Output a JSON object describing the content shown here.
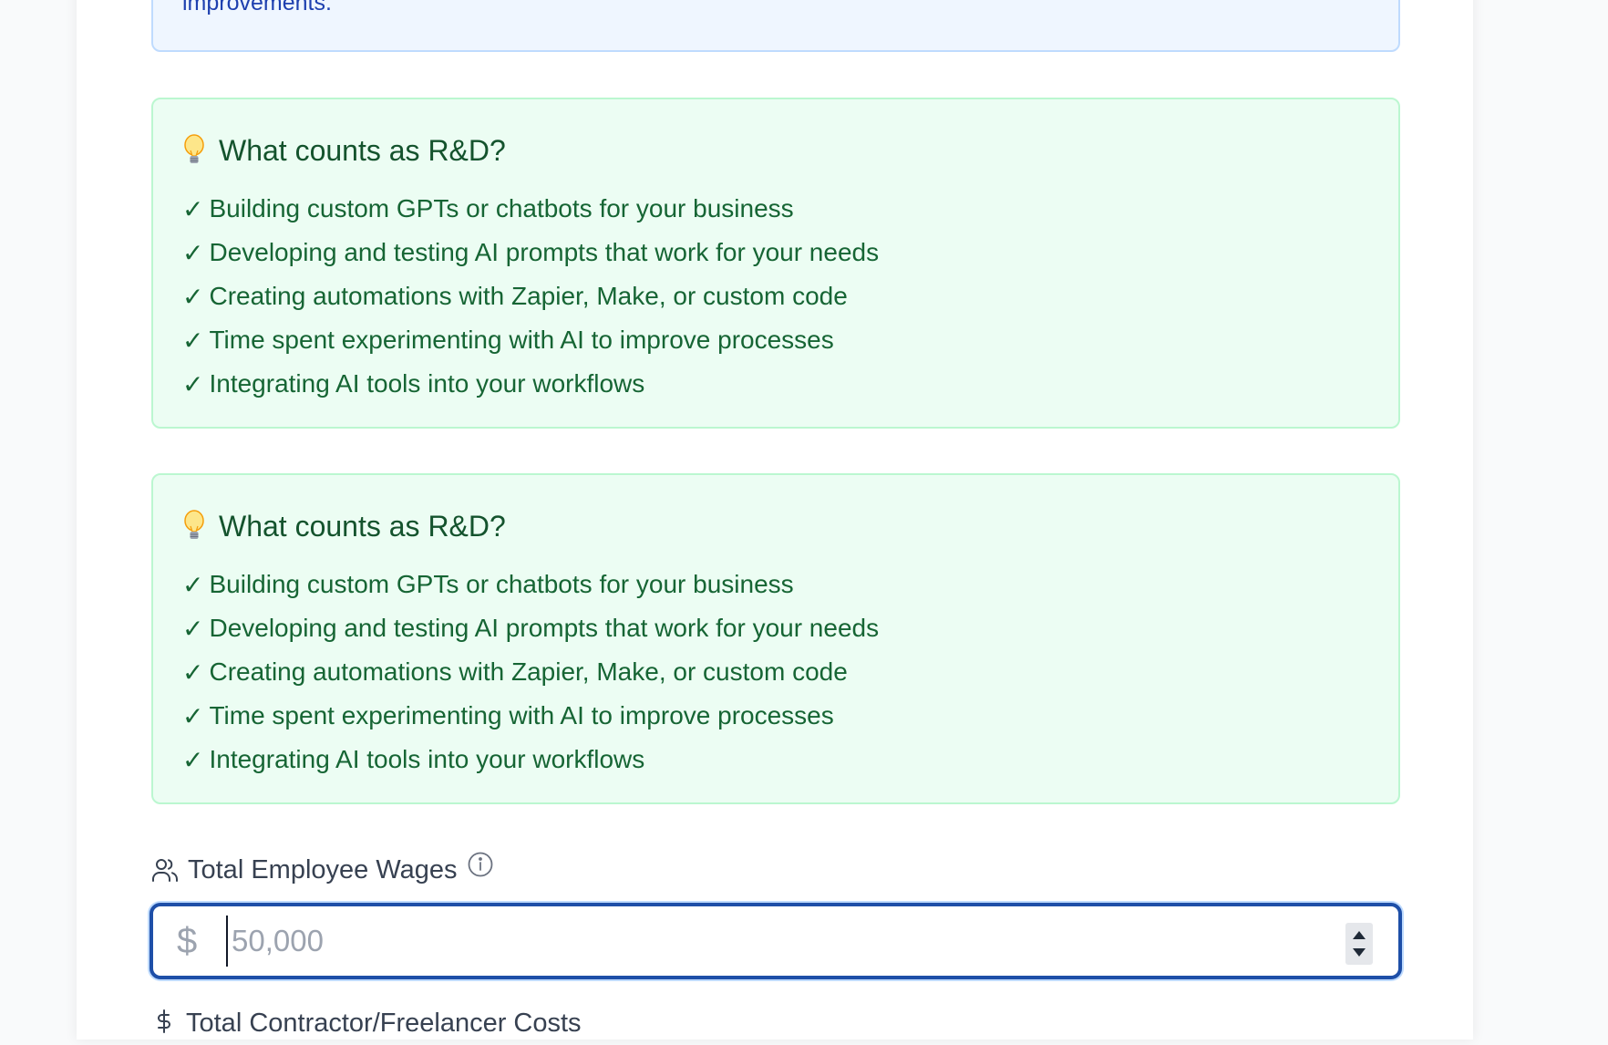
{
  "info_box": {
    "text": "improvements."
  },
  "rd_sections": [
    {
      "title": "What counts as R&D?",
      "icon": "lightbulb-icon",
      "items": [
        "Building custom GPTs or chatbots for your business",
        "Developing and testing AI prompts that work for your needs",
        "Creating automations with Zapier, Make, or custom code",
        "Time spent experimenting with AI to improve processes",
        "Integrating AI tools into your workflows"
      ]
    },
    {
      "title": "What counts as R&D?",
      "icon": "lightbulb-icon",
      "items": [
        "Building custom GPTs or chatbots for your business",
        "Developing and testing AI prompts that work for your needs",
        "Creating automations with Zapier, Make, or custom code",
        "Time spent experimenting with AI to improve processes",
        "Integrating AI tools into your workflows"
      ]
    }
  ],
  "check_mark": "✓",
  "wages_field": {
    "label": "Total Employee Wages",
    "currency_symbol": "$",
    "value": "",
    "placeholder": "50,000"
  },
  "next_field": {
    "label": "Total Contractor/Freelancer Costs"
  },
  "colors": {
    "info_bg": "#eff6ff",
    "info_text": "#1e40af",
    "rd_bg": "#ecfdf3",
    "rd_border": "#bbf7d0",
    "rd_text": "#166534",
    "input_focus_border": "#1e4fa8"
  }
}
